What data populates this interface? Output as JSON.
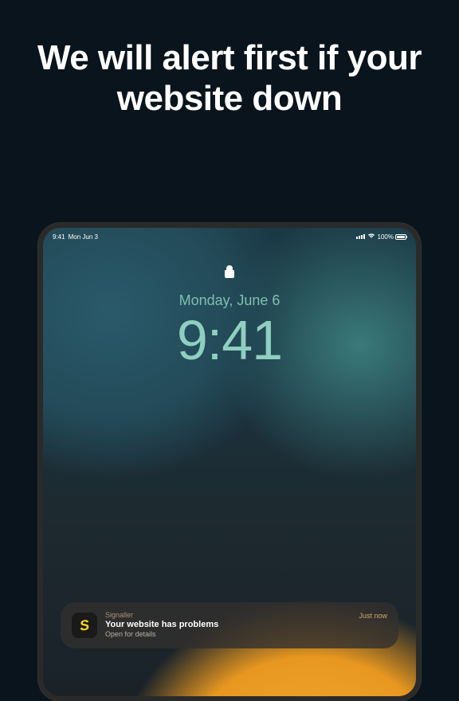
{
  "headline": "We will alert first if your website down",
  "statusbar": {
    "time": "9:41",
    "day": "Mon Jun 3",
    "battery": "100%"
  },
  "lockscreen": {
    "date": "Monday, June 6",
    "time": "9:41"
  },
  "notification": {
    "app": "Signaller",
    "title": "Your website has problems",
    "body": "Open for details",
    "time": "Just now"
  }
}
